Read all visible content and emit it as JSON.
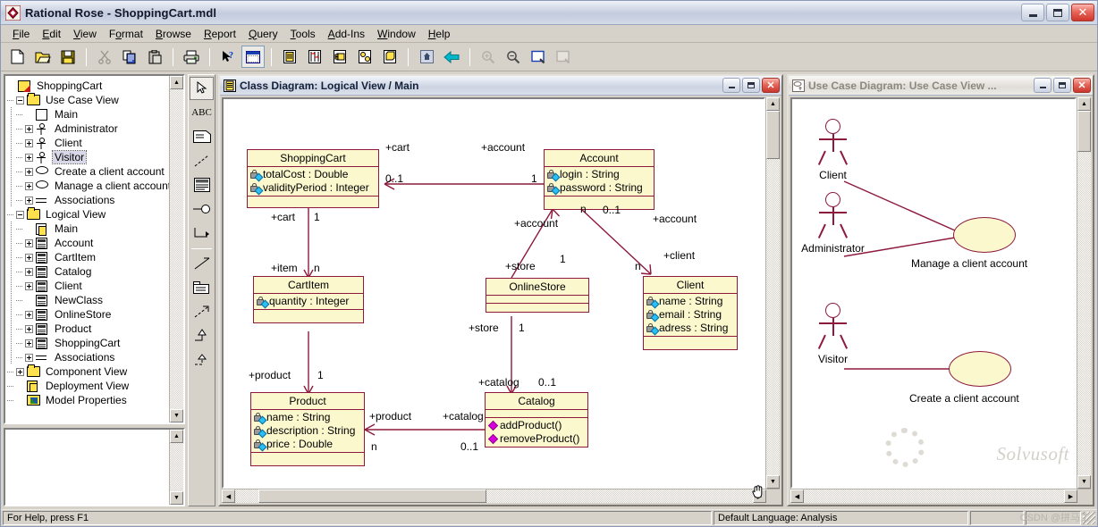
{
  "window": {
    "title": "Rational Rose - ShoppingCart.mdl",
    "icon": "rational-rose-icon",
    "minimize": "_",
    "maximize": "□",
    "close": "✕"
  },
  "menu": [
    {
      "label": "File"
    },
    {
      "label": "Edit"
    },
    {
      "label": "View"
    },
    {
      "label": "Format"
    },
    {
      "label": "Browse"
    },
    {
      "label": "Report"
    },
    {
      "label": "Query"
    },
    {
      "label": "Tools"
    },
    {
      "label": "Add-Ins"
    },
    {
      "label": "Window"
    },
    {
      "label": "Help"
    }
  ],
  "toolbar": [
    {
      "name": "new-model-button",
      "icon": "new-document-icon"
    },
    {
      "name": "open-model-button",
      "icon": "open-folder-icon"
    },
    {
      "name": "save-model-button",
      "icon": "floppy-save-icon"
    },
    {
      "sep": true
    },
    {
      "name": "cut-button",
      "icon": "scissors-icon"
    },
    {
      "name": "copy-button",
      "icon": "copy-icon"
    },
    {
      "name": "paste-button",
      "icon": "paste-icon"
    },
    {
      "sep": true
    },
    {
      "name": "print-button",
      "icon": "printer-icon"
    },
    {
      "sep": true
    },
    {
      "name": "context-help-button",
      "icon": "arrow-question-icon"
    },
    {
      "name": "browse-class-diagram-button",
      "icon": "blue-window-icon",
      "selected": true
    },
    {
      "sep": true
    },
    {
      "name": "browse-class-diagram-2-button",
      "icon": "class-diagram-icon"
    },
    {
      "name": "browse-interaction-diagram-button",
      "icon": "interaction-diagram-icon"
    },
    {
      "name": "browse-component-diagram-button",
      "icon": "component-diagram-icon"
    },
    {
      "name": "browse-state-machine-diagram-button",
      "icon": "state-diagram-icon"
    },
    {
      "name": "browse-deployment-diagram-button",
      "icon": "deployment-diagram-icon"
    },
    {
      "sep": true
    },
    {
      "name": "browse-parent-button",
      "icon": "parent-icon"
    },
    {
      "name": "browse-previous-diagram-button",
      "icon": "back-arrow-icon"
    },
    {
      "sep": true
    },
    {
      "name": "zoom-in-button",
      "icon": "zoom-in-icon",
      "disabled": true
    },
    {
      "name": "zoom-out-button",
      "icon": "zoom-out-icon"
    },
    {
      "name": "fit-in-window-button",
      "icon": "fit-window-icon"
    },
    {
      "name": "undo-fit-in-window-button",
      "icon": "undo-fit-icon",
      "disabled": true
    }
  ],
  "browser": {
    "tree": [
      {
        "label": "ShoppingCart",
        "depth": 0,
        "icon": "model-icon",
        "expander": "none"
      },
      {
        "label": "Use Case View",
        "depth": 1,
        "icon": "folder-icon",
        "expander": "minus"
      },
      {
        "label": "Main",
        "depth": 2,
        "icon": "usecase-diagram-icon",
        "expander": "none"
      },
      {
        "label": "Administrator",
        "depth": 2,
        "icon": "actor-icon",
        "expander": "plus"
      },
      {
        "label": "Client",
        "depth": 2,
        "icon": "actor-icon",
        "expander": "plus"
      },
      {
        "label": "Visitor",
        "depth": 2,
        "icon": "actor-icon",
        "expander": "plus",
        "selected": true
      },
      {
        "label": "Create a client account",
        "depth": 2,
        "icon": "usecase-icon",
        "expander": "plus"
      },
      {
        "label": "Manage a client account",
        "depth": 2,
        "icon": "usecase-icon",
        "expander": "plus"
      },
      {
        "label": "Associations",
        "depth": 2,
        "icon": "associations-icon",
        "expander": "plus"
      },
      {
        "label": "Logical View",
        "depth": 1,
        "icon": "folder-icon",
        "expander": "minus"
      },
      {
        "label": "Main",
        "depth": 2,
        "icon": "class-diagram-icon",
        "expander": "none"
      },
      {
        "label": "Account",
        "depth": 2,
        "icon": "class-icon",
        "expander": "plus"
      },
      {
        "label": "CartItem",
        "depth": 2,
        "icon": "class-icon",
        "expander": "plus"
      },
      {
        "label": "Catalog",
        "depth": 2,
        "icon": "class-icon",
        "expander": "plus"
      },
      {
        "label": "Client",
        "depth": 2,
        "icon": "class-icon",
        "expander": "plus"
      },
      {
        "label": "NewClass",
        "depth": 2,
        "icon": "class-icon",
        "expander": "none"
      },
      {
        "label": "OnlineStore",
        "depth": 2,
        "icon": "class-icon",
        "expander": "plus"
      },
      {
        "label": "Product",
        "depth": 2,
        "icon": "class-icon",
        "expander": "plus"
      },
      {
        "label": "ShoppingCart",
        "depth": 2,
        "icon": "class-icon",
        "expander": "plus"
      },
      {
        "label": "Associations",
        "depth": 2,
        "icon": "associations-icon",
        "expander": "plus"
      },
      {
        "label": "Component View",
        "depth": 1,
        "icon": "folder-icon",
        "expander": "plus"
      },
      {
        "label": "Deployment View",
        "depth": 1,
        "icon": "deployment-icon",
        "expander": "none"
      },
      {
        "label": "Model Properties",
        "depth": 1,
        "icon": "properties-icon",
        "expander": "none"
      }
    ]
  },
  "palette": [
    {
      "name": "selection-tool",
      "icon": "arrow-cursor-icon",
      "selected": true
    },
    {
      "name": "text-tool",
      "icon": "abc-text-icon",
      "label": "ABC"
    },
    {
      "name": "note-tool",
      "icon": "note-icon"
    },
    {
      "name": "note-anchor-tool",
      "icon": "dashed-line-icon"
    },
    {
      "name": "class-tool",
      "icon": "class-box-icon"
    },
    {
      "name": "interface-tool",
      "icon": "lollipop-interface-icon"
    },
    {
      "name": "unidirectional-association-tool",
      "icon": "right-angle-arrow-icon"
    },
    {
      "sep": true
    },
    {
      "name": "association-tool",
      "icon": "plain-line-icon"
    },
    {
      "name": "package-tool",
      "icon": "package-icon"
    },
    {
      "name": "dependency-tool",
      "icon": "dashed-arrow-icon"
    },
    {
      "name": "generalization-tool",
      "icon": "generalization-arrow-icon"
    },
    {
      "name": "realize-tool",
      "icon": "realize-dashed-arrow-icon"
    }
  ],
  "class_diagram": {
    "title": "Class Diagram: Logical View / Main",
    "icon": "class-diagram-icon",
    "buttons": {
      "minimize": "_",
      "maximize": "□",
      "close": "✕"
    },
    "classes": [
      {
        "name": "ShoppingCart",
        "attributes": [
          "totalCost : Double",
          "validityPeriod : Integer"
        ],
        "operations": []
      },
      {
        "name": "Account",
        "attributes": [
          "login : String",
          "password : String"
        ],
        "operations": []
      },
      {
        "name": "CartItem",
        "attributes": [
          "quantity : Integer"
        ],
        "operations": []
      },
      {
        "name": "OnlineStore",
        "attributes": [],
        "operations": []
      },
      {
        "name": "Client",
        "attributes": [
          "name : String",
          "email : String",
          "adress : String"
        ],
        "operations": []
      },
      {
        "name": "Product",
        "attributes": [
          "name : String",
          "description : String",
          "price : Double"
        ],
        "operations": []
      },
      {
        "name": "Catalog",
        "attributes": [],
        "operations": [
          "addProduct()",
          "removeProduct()"
        ]
      }
    ],
    "edge_labels": [
      "+cart",
      "0..1",
      "+account",
      "1",
      "+cart",
      "1",
      "+item",
      "n",
      "+account",
      "n",
      "0..1",
      "+account",
      "+store",
      "1",
      "+client",
      "n",
      "+store",
      "1",
      "+catalog",
      "0..1",
      "+product",
      "1",
      "+product",
      "n",
      "+catalog",
      "0..1"
    ]
  },
  "use_case_diagram": {
    "title": "Use Case Diagram: Use Case View ...",
    "icon": "usecase-diagram-icon",
    "buttons": {
      "minimize": "_",
      "maximize": "□",
      "close": "✕"
    },
    "actors": [
      {
        "label": "Client"
      },
      {
        "label": "Administrator"
      },
      {
        "label": "Visitor"
      }
    ],
    "use_cases": [
      {
        "label": "Manage a client account"
      },
      {
        "label": "Create a client account"
      }
    ]
  },
  "statusbar": {
    "help": "For Help, press F1",
    "language": "Default Language: Analysis",
    "pane3": "",
    "pane4": ""
  },
  "watermark": {
    "brand": "Solvusoft",
    "credit": "CSDN @拼马工"
  },
  "colors": {
    "uml_border": "#8d1a3d",
    "uml_fill": "#fbf8cd",
    "folder": "#ffe14d",
    "titlebar_active": "#ccd3e2",
    "desktop": "#d6d2ca"
  }
}
